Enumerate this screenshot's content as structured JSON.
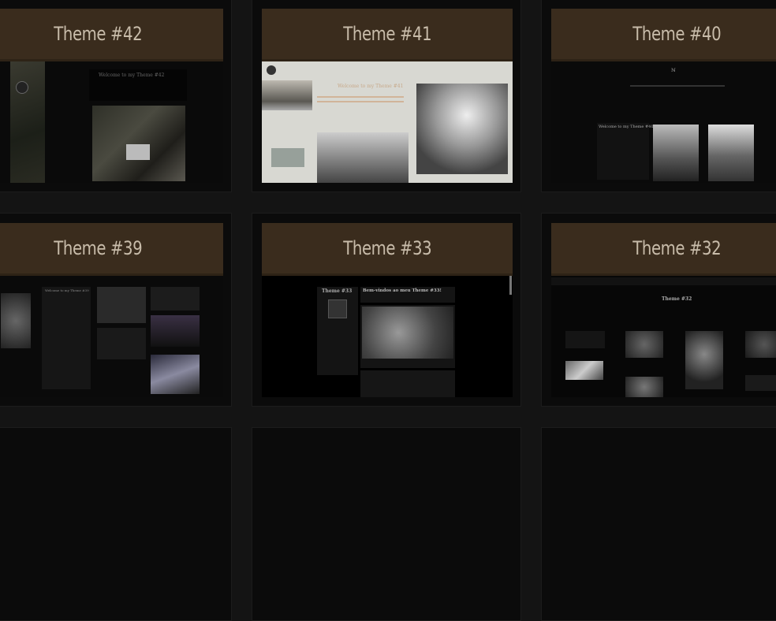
{
  "themes": [
    {
      "title": "Theme #42",
      "preview_heading": "Welcome to my Theme #42"
    },
    {
      "title": "Theme #41",
      "preview_heading": "Welcome to my Theme #41"
    },
    {
      "title": "Theme #40",
      "preview_heading": "Welcome to my Theme #40"
    },
    {
      "title": "Theme #39",
      "preview_heading": "Welcome to my Theme #39"
    },
    {
      "title": "Theme #33",
      "preview_heading": "Bem-vindos ao meu Theme #33!",
      "preview_sidebar": "Theme #33"
    },
    {
      "title": "Theme #32",
      "preview_heading": "Theme #32"
    }
  ],
  "colors": {
    "header": "#3a2c1d",
    "title": "#c8bcaa",
    "background": "#141414"
  }
}
